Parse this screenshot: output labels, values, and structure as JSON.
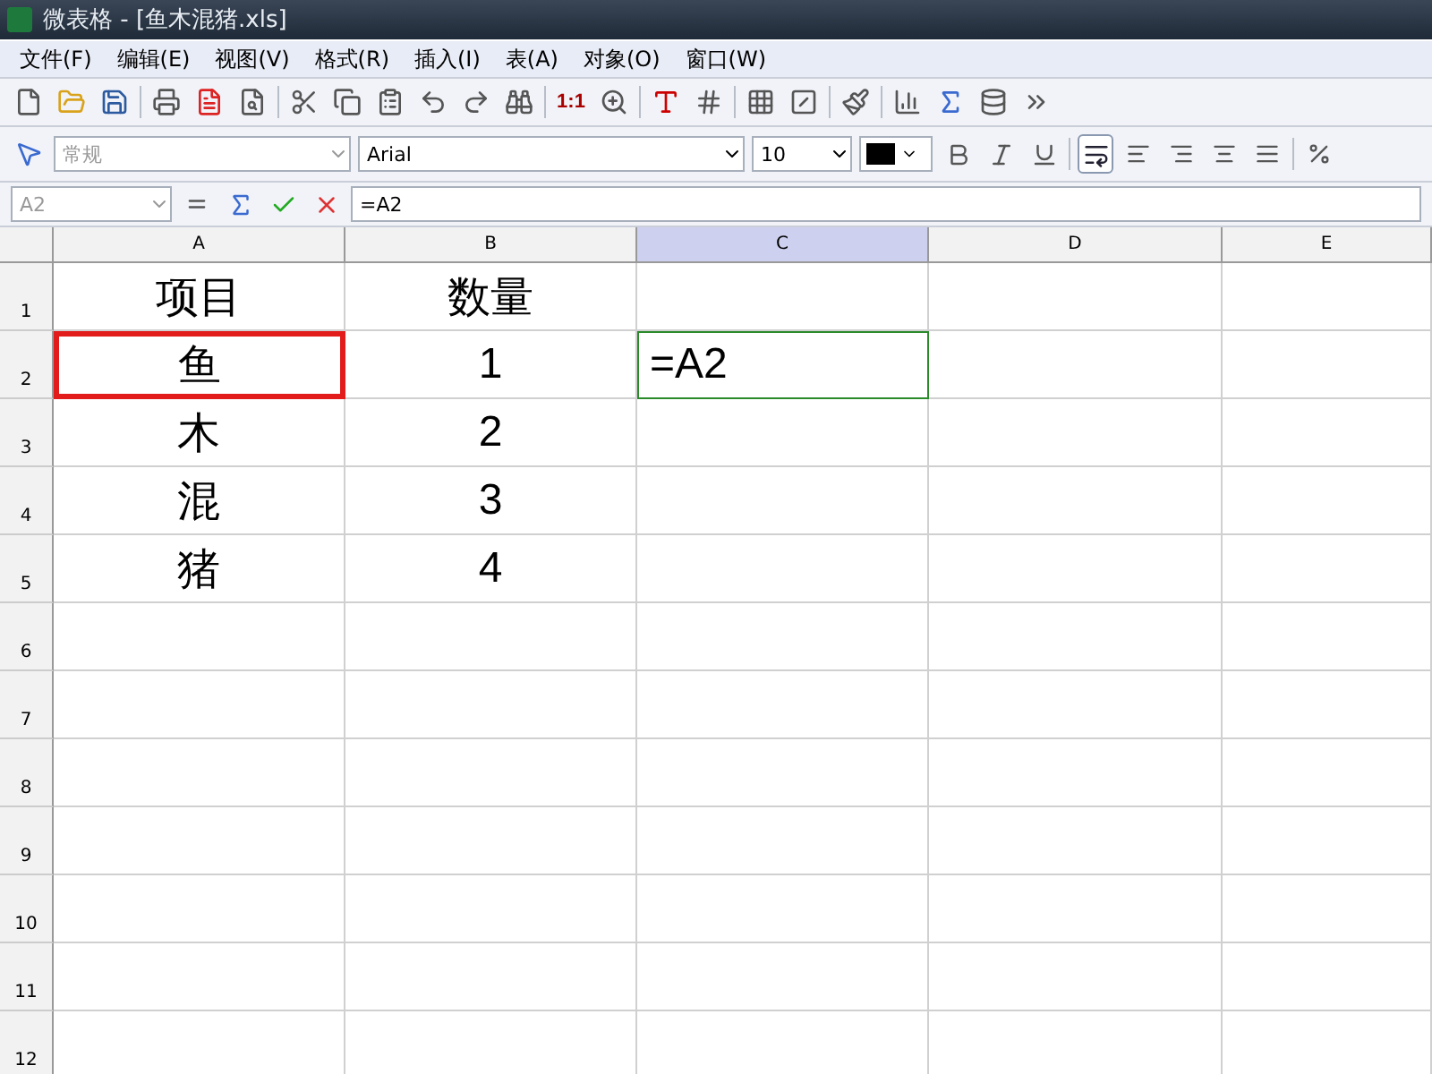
{
  "window": {
    "title": "微表格 - [鱼木混猪.xls]"
  },
  "menu": [
    "文件(F)",
    "编辑(E)",
    "视图(V)",
    "格式(R)",
    "插入(I)",
    "表(A)",
    "对象(O)",
    "窗口(W)"
  ],
  "toolbar": [
    {
      "kind": "new"
    },
    {
      "kind": "open"
    },
    {
      "kind": "save"
    },
    {
      "kind": "sep"
    },
    {
      "kind": "print"
    },
    {
      "kind": "pdf"
    },
    {
      "kind": "preview"
    },
    {
      "kind": "sep"
    },
    {
      "kind": "cut"
    },
    {
      "kind": "copy"
    },
    {
      "kind": "paste"
    },
    {
      "kind": "undo"
    },
    {
      "kind": "redo"
    },
    {
      "kind": "find"
    },
    {
      "kind": "sep"
    },
    {
      "kind": "ratio",
      "label": "1:1"
    },
    {
      "kind": "zoom"
    },
    {
      "kind": "sep"
    },
    {
      "kind": "fontcolor"
    },
    {
      "kind": "grid"
    },
    {
      "kind": "sep"
    },
    {
      "kind": "borders"
    },
    {
      "kind": "fill"
    },
    {
      "kind": "sep"
    },
    {
      "kind": "brush"
    },
    {
      "kind": "sep"
    },
    {
      "kind": "chart"
    },
    {
      "kind": "sum"
    },
    {
      "kind": "db"
    },
    {
      "kind": "more"
    }
  ],
  "format_bar": {
    "style": "常规",
    "font": "Arial",
    "size": "10",
    "bold": false,
    "italic": false,
    "underline": false,
    "wrap": true
  },
  "formula_bar": {
    "cell": "A2",
    "formula": "=A2"
  },
  "columns": [
    {
      "label": "A",
      "selected": false
    },
    {
      "label": "B",
      "selected": false
    },
    {
      "label": "C",
      "selected": true
    },
    {
      "label": "D",
      "selected": false
    },
    {
      "label": "E",
      "selected": false
    }
  ],
  "rows": [
    {
      "number": "1",
      "cells": [
        {
          "kind": "plain",
          "value": "项目"
        },
        {
          "kind": "plain",
          "value": "数量"
        }
      ]
    },
    {
      "number": "2",
      "cells": [
        {
          "kind": "marked",
          "value": "鱼"
        },
        {
          "kind": "plain",
          "value": "1"
        },
        {
          "kind": "editing",
          "value": "=A2"
        }
      ]
    },
    {
      "number": "3",
      "cells": [
        {
          "kind": "plain",
          "value": "木"
        },
        {
          "kind": "plain",
          "value": "2"
        }
      ]
    },
    {
      "number": "4",
      "cells": [
        {
          "kind": "plain",
          "value": "混"
        },
        {
          "kind": "plain",
          "value": "3"
        }
      ]
    },
    {
      "number": "5",
      "cells": [
        {
          "kind": "plain",
          "value": "猪"
        },
        {
          "kind": "plain",
          "value": "4"
        }
      ]
    },
    {
      "number": "6"
    },
    {
      "number": "7"
    },
    {
      "number": "8"
    },
    {
      "number": "9"
    },
    {
      "number": "10"
    },
    {
      "number": "11"
    },
    {
      "number": "12"
    }
  ]
}
